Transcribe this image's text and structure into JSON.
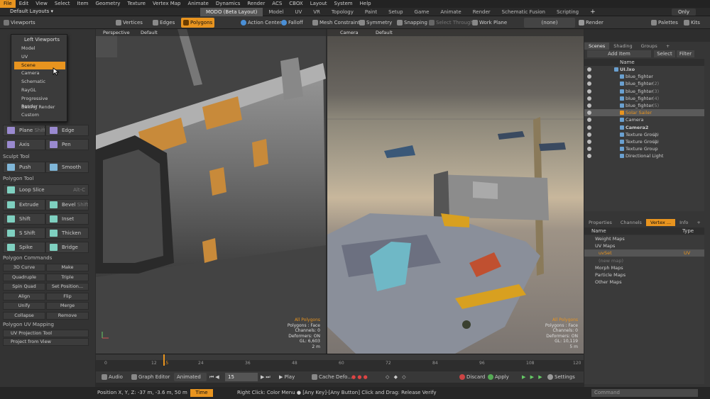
{
  "menu": [
    "File",
    "Edit",
    "View",
    "Select",
    "Item",
    "Geometry",
    "Texture",
    "Vertex Map",
    "Animate",
    "Dynamics",
    "Render",
    "ACS",
    "CBOX",
    "Layout",
    "System",
    "Help"
  ],
  "layout": {
    "selector": "Default Layouts ▾",
    "tabs": [
      "MODO (Beta Layout)",
      "Model",
      "UV",
      "VR",
      "Topology",
      "Paint",
      "Setup",
      "Game",
      "Animate",
      "Render",
      "Schematic Fusion",
      "Scripting",
      "+"
    ],
    "active_tab": "MODO (Beta Layout)",
    "only_label": "Only"
  },
  "toolbar": {
    "viewports": "Viewports",
    "vertices": "Vertices",
    "edges": "Edges",
    "polygons": "Polygons",
    "action_center": "Action Center",
    "falloff": "Falloff",
    "mesh_constraint": "Mesh Constraint",
    "symmetry": "Symmetry",
    "snapping": "Snapping",
    "select_through": "Select Through",
    "work_plane": "Work Plane",
    "none": "(none)",
    "render": "Render",
    "palettes": "Palettes",
    "kits": "Kits"
  },
  "left": {
    "menu_title": "Left Viewports",
    "menu_items": [
      "Model",
      "UV",
      "Scene",
      "Camera",
      "Schematic",
      "RayGL",
      "Progressive Render",
      "Baking Render",
      "Custom"
    ],
    "selected_item": "Scene",
    "tools_row1": [
      {
        "label": "Plane",
        "hint": "Shift-B"
      },
      {
        "label": "Edge"
      }
    ],
    "tools_row2": [
      {
        "label": "Axis"
      },
      {
        "label": "Pen"
      }
    ],
    "sculpt_title": "Sculpt Tool",
    "sculpt": [
      "Push",
      "Smooth"
    ],
    "poly_title": "Polygon Tool",
    "poly_row0": {
      "label": "Loop Slice",
      "hint": "Alt-C"
    },
    "poly_row1": [
      {
        "label": "Extrude"
      },
      {
        "label": "Bevel",
        "hint": "Shift-B"
      }
    ],
    "poly_row2": [
      {
        "label": "Shift"
      },
      {
        "label": "Inset"
      }
    ],
    "poly_row3": [
      {
        "label": "S Shift"
      },
      {
        "label": "Thicken"
      }
    ],
    "poly_row4": [
      {
        "label": "Spike"
      },
      {
        "label": "Bridge"
      }
    ],
    "cmd_title": "Polygon Commands",
    "cmd_rows": [
      [
        "3D Curve",
        "Make"
      ],
      [
        "Quadruple",
        "Triple"
      ],
      [
        "Spin Quad",
        "Set Position..."
      ],
      [
        "Align",
        "Flip"
      ],
      [
        "Unify",
        "Merge"
      ],
      [
        "Collapse",
        "Remove"
      ]
    ],
    "uv_title": "Polygon UV Mapping",
    "uv_rows": [
      "UV Projection Tool",
      "Project from View"
    ]
  },
  "vp1": {
    "view": "Perspective",
    "style": "Default",
    "info": [
      "All Polygons",
      "Polygons : Face",
      "Channels: 0",
      "Deformers: ON",
      "GL: 6,603",
      "2 m"
    ]
  },
  "vp2": {
    "view": "Camera",
    "style": "Default",
    "info": [
      "All Polygons",
      "Polygons : Face",
      "Channels: 0",
      "Deformers: ON",
      "GL: 10,119",
      "5 m"
    ]
  },
  "timeline": {
    "ticks": [
      "0",
      "12",
      "15",
      "24",
      "36",
      "48",
      "60",
      "72",
      "84",
      "96",
      "108",
      "120"
    ],
    "current_frame": 15
  },
  "transport": {
    "audio": "Audio",
    "graph": "Graph Editor",
    "animated": "Animated",
    "frame": "15",
    "play": "Play",
    "cache": "Cache Defo...",
    "discard": "Discard",
    "apply": "Apply",
    "settings": "Settings"
  },
  "status": {
    "position": "Position X, Y, Z:  -37 m, -3.6 m, 50 m",
    "time": "Time",
    "hint": "Right Click: Color Menu ● [Any Key]-[Any Button] Click and Drag: Release Verify"
  },
  "scene": {
    "tabs": [
      "Scenes",
      "Shading",
      "Groups",
      "+"
    ],
    "add_item": "Add Item",
    "select": "Select",
    "filter": "Filter",
    "name_header": "Name",
    "items": [
      {
        "name": "UI.lxo",
        "count": "",
        "bold": true
      },
      {
        "name": "blue_fighter",
        "count": ""
      },
      {
        "name": "blue_fighter",
        "count": "(2)"
      },
      {
        "name": "blue_fighter",
        "count": "(3)"
      },
      {
        "name": "blue_fighter",
        "count": "(4)"
      },
      {
        "name": "blue_fighter",
        "count": "(5)"
      },
      {
        "name": "Solar Sailer",
        "count": "",
        "highlight": true
      },
      {
        "name": "Camera",
        "count": ""
      },
      {
        "name": "Camera2",
        "count": "",
        "bold": true
      },
      {
        "name": "Texture Group",
        "count": "(2)"
      },
      {
        "name": "Texture Group",
        "count": "(3)"
      },
      {
        "name": "Texture Group",
        "count": ""
      },
      {
        "name": "Directional Light",
        "count": ""
      }
    ]
  },
  "vertex": {
    "tabs": [
      "Properties",
      "Channels",
      "Vertex ...",
      "Info",
      "+"
    ],
    "name_header": "Name",
    "type_header": "Type",
    "items": [
      {
        "name": "Weight Maps",
        "type": ""
      },
      {
        "name": "UV Maps",
        "type": ""
      },
      {
        "name": "uvSet",
        "type": "UV",
        "selected": true
      },
      {
        "name": "(new map)",
        "type": "",
        "dim": true
      },
      {
        "name": "Morph Maps",
        "type": ""
      },
      {
        "name": "Particle Maps",
        "type": ""
      },
      {
        "name": "Other Maps",
        "type": ""
      }
    ],
    "command": "Command"
  },
  "colors": {
    "accent": "#e8941f",
    "panel": "#333333",
    "viewport": "#434343"
  }
}
